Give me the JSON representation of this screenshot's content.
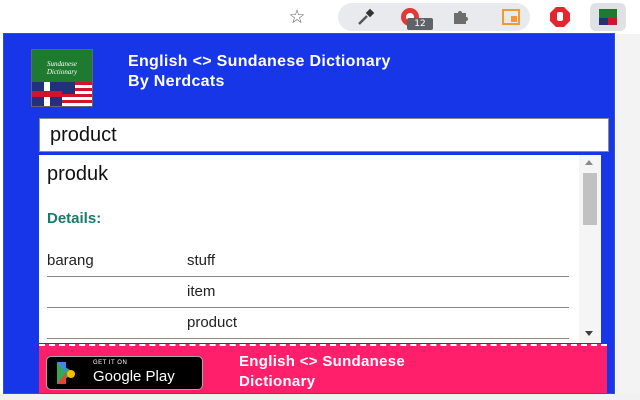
{
  "toolbar": {
    "icons": [
      "star-icon",
      "eyedropper-icon",
      "ext-red-icon",
      "puzzle-icon",
      "layout-icon",
      "adblock-icon",
      "dictionary-ext-icon"
    ],
    "badge": "12"
  },
  "header": {
    "title_line1": "English <> Sundanese Dictionary",
    "title_line2": "By Nerdcats",
    "logo_text": "Sundanese Dictionary"
  },
  "search": {
    "value": "product"
  },
  "result": {
    "translation": "produk",
    "details_label": "Details:",
    "rows": [
      {
        "word": "barang",
        "meaning": "stuff"
      },
      {
        "word": "",
        "meaning": "item"
      },
      {
        "word": "",
        "meaning": "product"
      }
    ]
  },
  "banner": {
    "store_small": "GET IT ON",
    "store_big": "Google Play",
    "line1": "English <> Sundanese",
    "line2": "Dictionary"
  },
  "colors": {
    "popup_bg": "#1736e8",
    "banner_bg": "#ff1f6b",
    "details": "#1a7a6e"
  }
}
